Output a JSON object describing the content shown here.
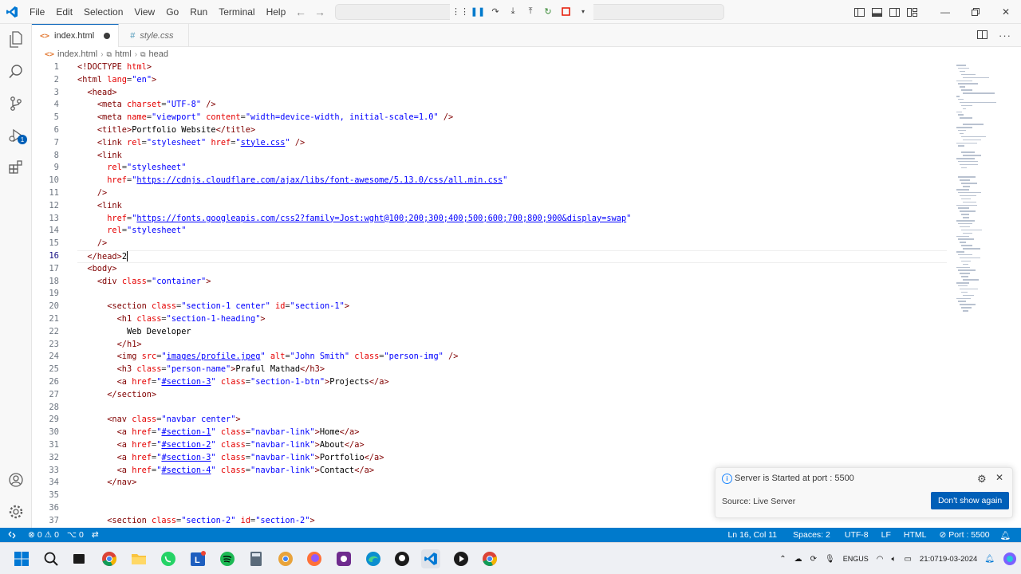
{
  "menu": [
    "File",
    "Edit",
    "Selection",
    "View",
    "Go",
    "Run",
    "Terminal",
    "Help"
  ],
  "tabs": [
    {
      "label": "index.html",
      "modified": true,
      "icon": "html-file-icon"
    },
    {
      "label": "style.css",
      "modified": false,
      "icon": "css-file-icon"
    }
  ],
  "breadcrumb": [
    "index.html",
    "html",
    "head"
  ],
  "editor": {
    "current_line": 16,
    "line_numbers": [
      "1",
      "2",
      "3",
      "4",
      "5",
      "6",
      "7",
      "8",
      "9",
      "10",
      "11",
      "12",
      "13",
      "14",
      "15",
      "16",
      "17",
      "18",
      "19",
      "20",
      "21",
      "22",
      "23",
      "24",
      "25",
      "26",
      "27",
      "28",
      "29",
      "30",
      "31",
      "32",
      "33",
      "34",
      "35",
      "36",
      "37"
    ]
  },
  "notification": {
    "message": "Server is Started at port : 5500",
    "source": "Source: Live Server",
    "button": "Don't show again"
  },
  "statusbar": {
    "errors": "0",
    "warnings": "0",
    "ports": "0",
    "position": "Ln 16, Col 11",
    "spaces": "Spaces: 2",
    "encoding": "UTF-8",
    "eol": "LF",
    "language": "HTML",
    "live_port": "Port : 5500"
  },
  "activity_badges": {
    "run_debug": "1"
  },
  "taskbar": {
    "lang_top": "ENG",
    "lang_bottom": "US",
    "time": "21:07",
    "date": "19-03-2024"
  },
  "colors": {
    "accent": "#007acc",
    "button": "#005fb8",
    "tag": "#800000",
    "attr": "#e50000",
    "string": "#0000ff"
  }
}
